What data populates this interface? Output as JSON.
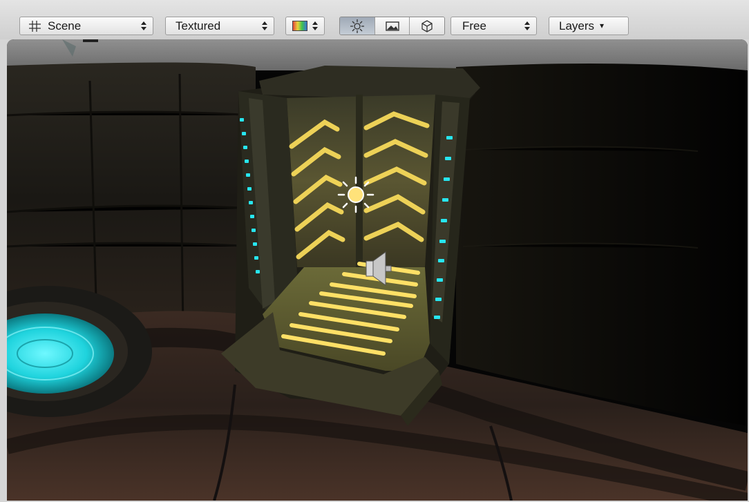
{
  "toolbar": {
    "scene_label": "Scene",
    "render_mode": "Textured",
    "camera_mode": "Free",
    "layers_label": "Layers",
    "layers_arrow": "▾"
  },
  "icons": [
    "grid-icon",
    "color-swatch-icon",
    "lighting-icon",
    "image-icon",
    "cube-icon",
    "light-gizmo-icon",
    "audio-source-icon"
  ],
  "colors": {
    "accent_cyan": "#27e6f0",
    "stripe_yellow": "#f6d95a",
    "viewport_bg": "#050505"
  }
}
